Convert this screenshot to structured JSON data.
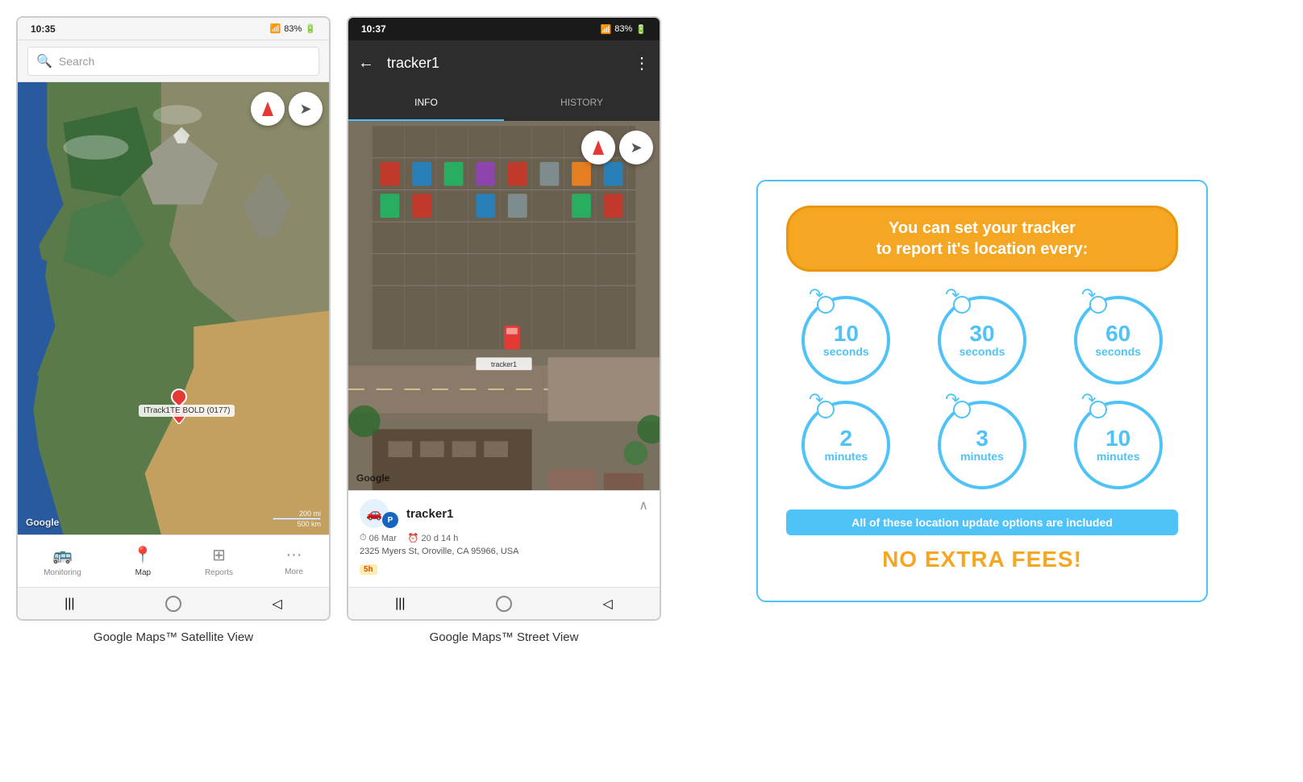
{
  "phone1": {
    "status_time": "10:35",
    "signal": "▲▲▲",
    "battery": "83%",
    "search_placeholder": "Search",
    "compass_label": "compass",
    "navigate_label": "navigate",
    "google_label": "Google",
    "scale_text_1": "200 mi",
    "scale_text_2": "500 km",
    "tracker_label": "ITrack1TE BOLD (0177)",
    "nav_items": [
      {
        "label": "Monitoring",
        "icon": "🚌",
        "active": false
      },
      {
        "label": "Map",
        "icon": "📍",
        "active": true
      },
      {
        "label": "Reports",
        "icon": "⊞",
        "active": false
      },
      {
        "label": "More",
        "icon": "···",
        "active": false
      }
    ],
    "caption": "Google Maps™ Satellite View"
  },
  "phone2": {
    "status_time": "10:37",
    "signal": "▲▲▲",
    "battery": "83%",
    "header_title": "tracker1",
    "tab_info": "INFO",
    "tab_history": "HISTORY",
    "google_label": "Google",
    "tracker_detail": {
      "name": "tracker1",
      "date": "06 Mar",
      "duration": "20 d 14 h",
      "address": "2325 Myers St, Oroville, CA 95966, USA",
      "time_badge": "5h"
    },
    "caption": "Google Maps™ Street View"
  },
  "info_card": {
    "title_line1": "You can set your tracker",
    "title_line2": "to report it's location every:",
    "circles": [
      {
        "number": "10",
        "unit": "seconds"
      },
      {
        "number": "30",
        "unit": "seconds"
      },
      {
        "number": "60",
        "unit": "seconds"
      },
      {
        "number": "2",
        "unit": "minutes"
      },
      {
        "number": "3",
        "unit": "minutes"
      },
      {
        "number": "10",
        "unit": "minutes"
      }
    ],
    "banner_text": "All of these location update options are included",
    "no_fees_text": "NO EXTRA FEES!"
  }
}
